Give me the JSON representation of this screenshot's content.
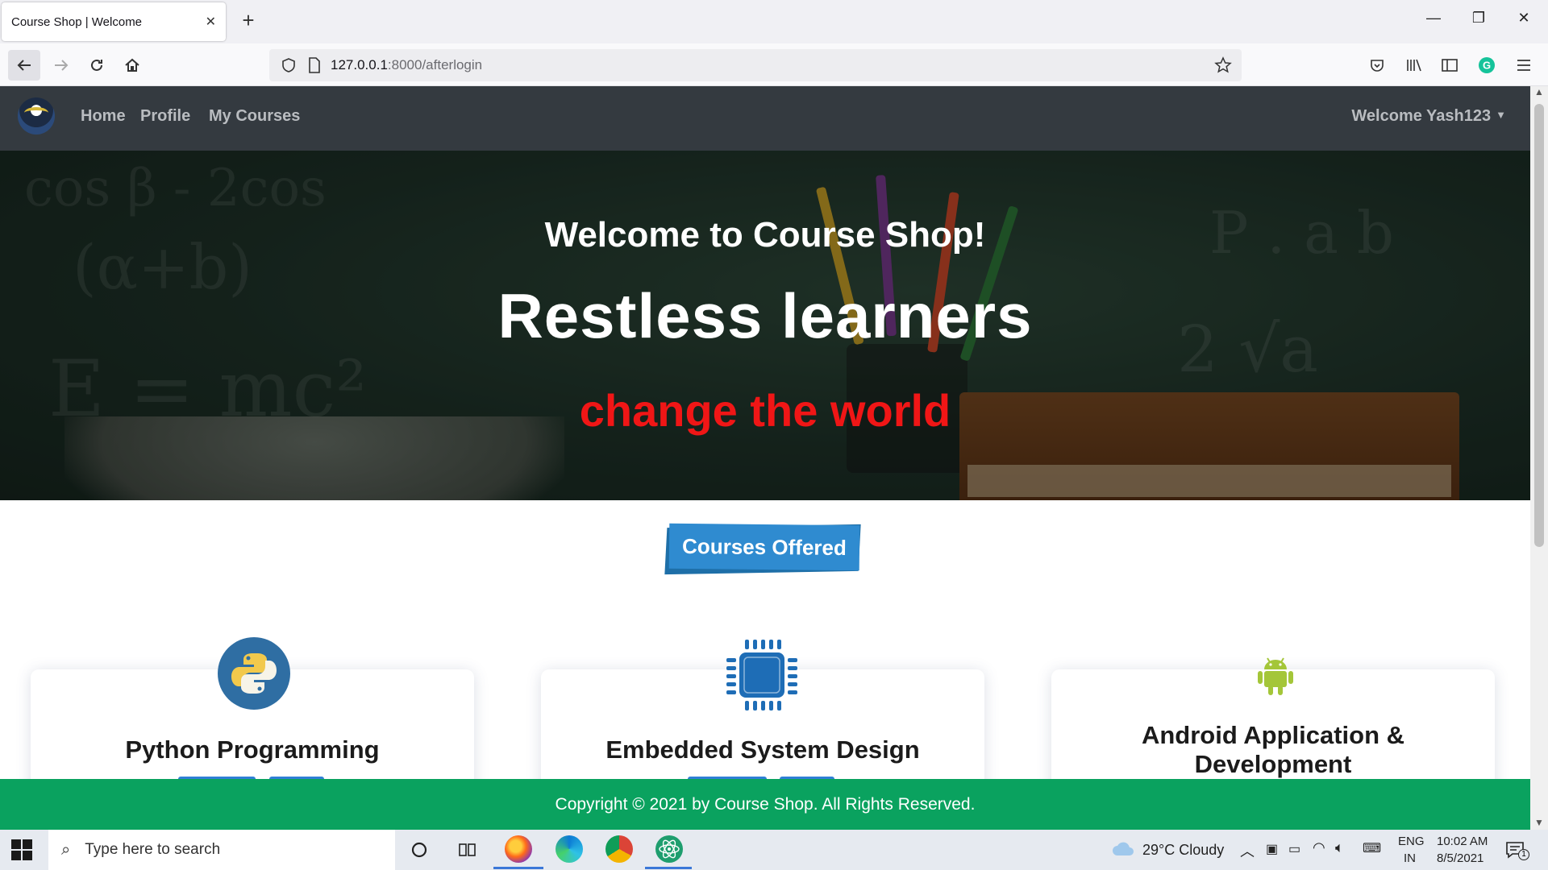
{
  "browser": {
    "tab_title": "Course Shop | Welcome",
    "tab_close": "✕",
    "new_tab": "+",
    "url_host": "127.0.0.1",
    "url_path": ":8000/afterlogin",
    "window_minimize": "—",
    "window_restore": "❐",
    "window_close": "✕"
  },
  "nav": {
    "links": [
      "Home",
      "Profile",
      "My Courses"
    ],
    "user": "Welcome Yash123"
  },
  "hero": {
    "line1": "Welcome to Course Shop!",
    "line2": "Restless learners",
    "line3": "change the world",
    "line3_color": "#f01616"
  },
  "section_title": "Courses Offered",
  "courses": [
    {
      "title": "Python Programming",
      "icon": "python-icon"
    },
    {
      "title": "Embedded System Design",
      "icon": "chip-icon"
    },
    {
      "title": "Android Application & Development",
      "icon": "android-icon"
    }
  ],
  "footer": "Copyright © 2021 by Course Shop. All Rights Reserved.",
  "taskbar": {
    "search_placeholder": "Type here to search",
    "weather": "29°C  Cloudy",
    "lang1": "ENG",
    "lang2": "IN",
    "time": "10:02 AM",
    "date": "8/5/2021",
    "notif_count": "1"
  },
  "colors": {
    "nav_bg": "#343a40",
    "footer_bg": "#0aa25f",
    "badge_bg": "#2f8bd0",
    "android_green": "#a4c639",
    "chip_blue": "#1e6db6"
  }
}
